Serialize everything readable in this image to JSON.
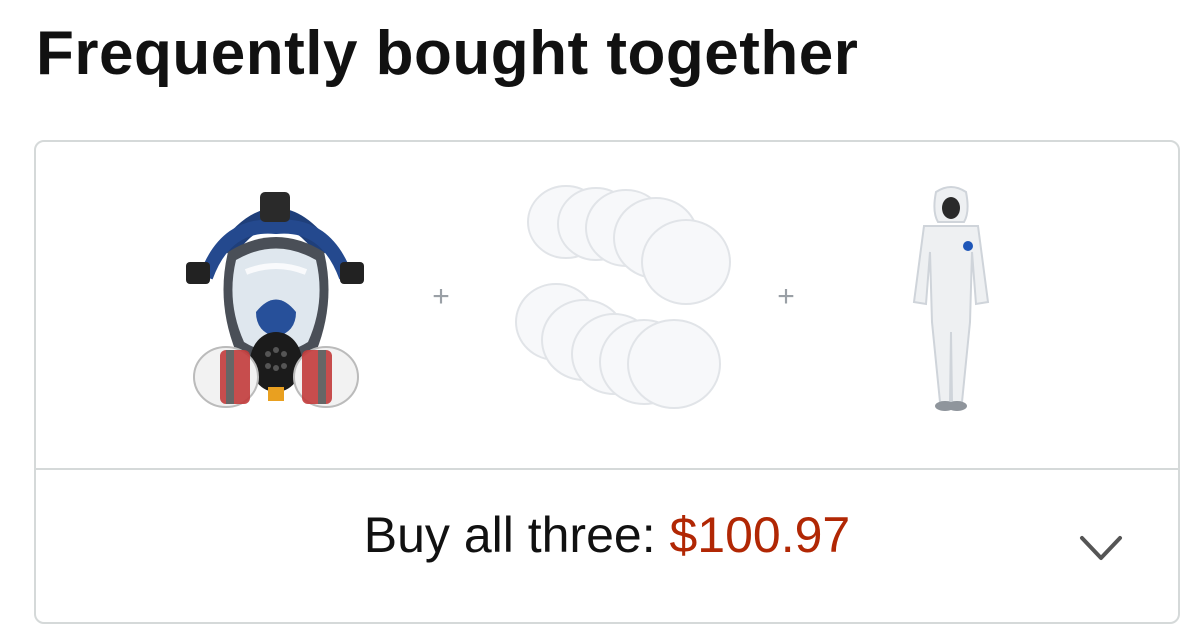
{
  "heading": "Frequently bought together",
  "products": [
    {
      "icon": "gas-mask-respirator"
    },
    {
      "icon": "filter-pads"
    },
    {
      "icon": "protective-coverall"
    }
  ],
  "separator": "+",
  "footer": {
    "label": "Buy all three: ",
    "price": "$100.97",
    "price_color": "#b12704",
    "expand_icon": "chevron-down-icon"
  }
}
